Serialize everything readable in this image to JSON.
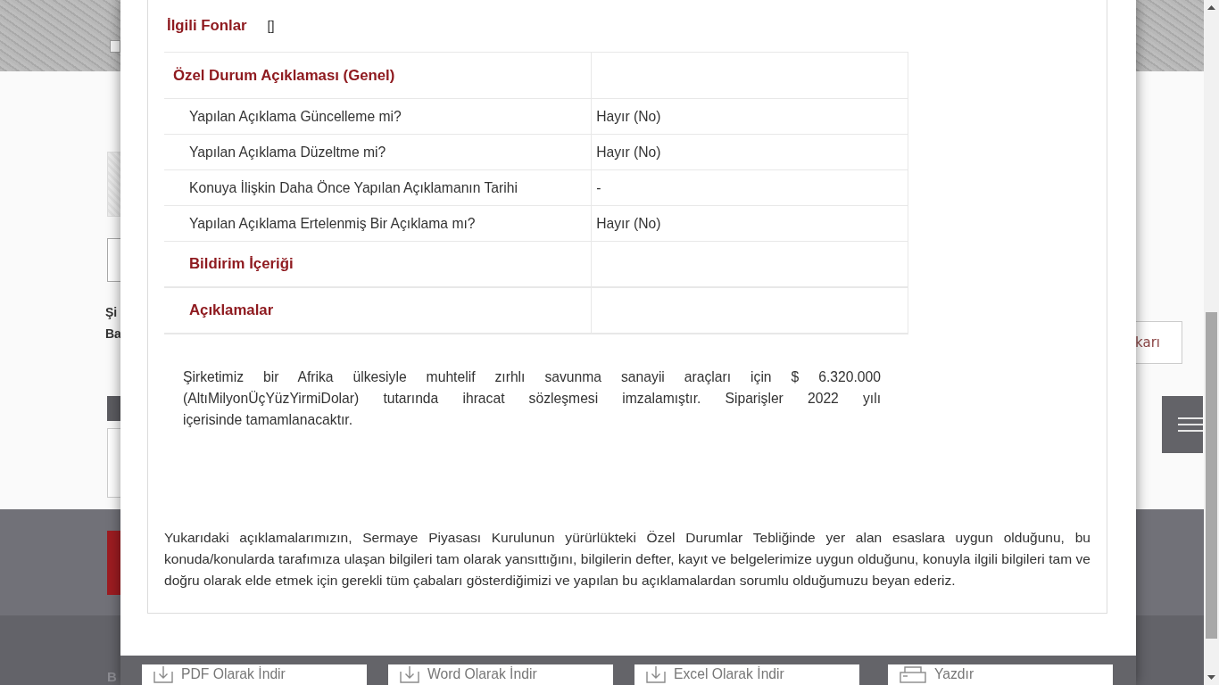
{
  "background_page": {
    "left_heading_lines": [
      "Şi",
      "Ba"
    ],
    "side_button": "karı",
    "footer_text": "B"
  },
  "modal": {
    "related_funds": {
      "label": "İlgili Fonlar",
      "value": "[]"
    },
    "table": {
      "rows": [
        {
          "kind": "section",
          "label": "Özel Durum Açıklaması (Genel)"
        },
        {
          "kind": "field",
          "label": "Yapılan Açıklama Güncelleme mi?",
          "value": "Hayır (No)"
        },
        {
          "kind": "field",
          "label": "Yapılan Açıklama Düzeltme mi?",
          "value": "Hayır (No)"
        },
        {
          "kind": "field",
          "label": "Konuya İlişkin Daha Önce Yapılan Açıklamanın Tarihi",
          "value": "-"
        },
        {
          "kind": "field",
          "label": "Yapılan Açıklama Ertelenmiş Bir Açıklama mı?",
          "value": "Hayır (No)"
        },
        {
          "kind": "subsection",
          "label": "Bildirim İçeriği"
        },
        {
          "kind": "subsection",
          "label": "Açıklamalar"
        }
      ]
    },
    "announcement": "Şirketimiz bir Afrika ülkesiyle muhtelif zırhlı savunma sanayii araçları için $ 6.320.000 (AltıMilyonÜçYüzYirmiDolar) tutarında ihracat sözleşmesi imzalamıştır. Siparişler 2022 yılı içerisinde tamamlanacaktır.",
    "declaration": "Yukarıdaki açıklamalarımızın, Sermaye Piyasası Kurulunun yürürlükteki Özel Durumlar Tebliğinde yer alan esaslara uygun olduğunu, bu konuda/konularda tarafımıza ulaşan bilgileri tam olarak yansıttığını, bilgilerin defter, kayıt ve belgelerimize uygun olduğunu, konuyla ilgili bilgileri tam ve doğru olarak elde etmek için gerekli tüm çabaları gösterdiğimizi ve yapılan bu açıklamalardan sorumlu olduğumuzu beyan ederiz.",
    "footer_buttons": [
      {
        "kind": "download",
        "label": "PDF Olarak İndir"
      },
      {
        "kind": "download",
        "label": "Word Olarak İndir"
      },
      {
        "kind": "download",
        "label": "Excel Olarak İndir"
      },
      {
        "kind": "print",
        "label": "Yazdır"
      }
    ]
  }
}
